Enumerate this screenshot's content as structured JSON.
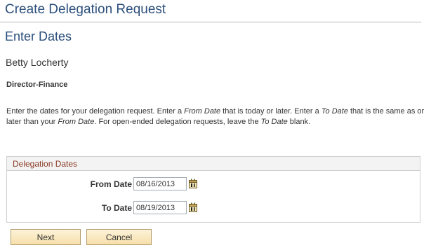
{
  "header": {
    "page_title": "Create Delegation Request",
    "section_title": "Enter Dates"
  },
  "person": {
    "name": "Betty Locherty",
    "job_title": "Director-Finance"
  },
  "instructions": {
    "part1": "Enter the dates for your delegation request. Enter a ",
    "em1": "From Date",
    "part2": " that is today or later. Enter a ",
    "em2": "To Date",
    "part3": " that is the same as or later than your ",
    "em3": "From Date",
    "part4": ". For open-ended delegation requests, leave the ",
    "em4": "To Date",
    "part5": " blank."
  },
  "delegation_dates": {
    "group_title": "Delegation Dates",
    "from_label": "From Date",
    "from_value": "08/16/2013",
    "to_label": "To Date",
    "to_value": "08/19/2013",
    "calendar_icon": "calendar-icon"
  },
  "actions": {
    "next_label": "Next",
    "cancel_label": "Cancel"
  },
  "colors": {
    "title_blue": "#2c4f7c",
    "group_title_red": "#8a3a24",
    "button_fill": "#f6dfa9"
  }
}
